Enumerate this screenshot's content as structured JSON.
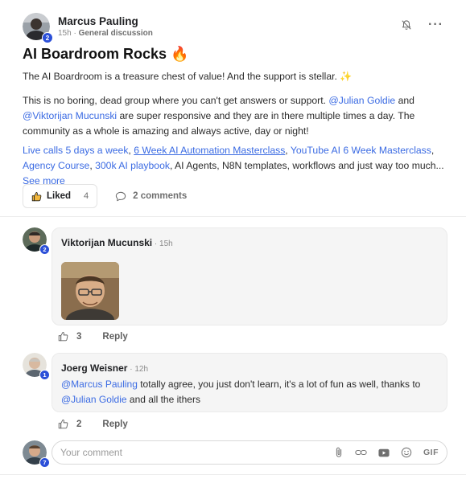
{
  "post": {
    "author": "Marcus Pauling",
    "author_level": "2",
    "time": "15h",
    "separator": " · ",
    "category": "General discussion",
    "title": "AI Boardroom Rocks",
    "title_emoji": "🔥",
    "p1": "The AI Boardroom is a treasure chest of value! And the support is stellar.",
    "p1_emoji": "✨",
    "p2_a": "This is no boring, dead group where you can't get answers or support. ",
    "p2_mention1": "@Julian Goldie",
    "p2_b": " and ",
    "p2_mention2": "@Viktorijan Mucunski",
    "p2_c": " are super responsive and they are in there multiple times a day. The community as a whole is amazing and always active, day or night!",
    "p3_link1": "Live calls 5 days a week",
    "p3_sep1": ", ",
    "p3_link2": "6 Week AI Automation Masterclass",
    "p3_sep2": ", ",
    "p3_link3": "YouTube AI 6 Week Masterclass",
    "p3_sep3": ", ",
    "p3_link4": "Agency Course",
    "p3_sep4": ", ",
    "p3_link5": "300k AI playbook",
    "p3_rest": ", AI Agents, N8N templates, workflows and just way too much... ",
    "see_more": "See more",
    "liked_label": "Liked",
    "like_count": "4",
    "comments_label": "2 comments",
    "icons": {
      "bell": "bell-off-icon",
      "more": "more-icon",
      "like": "thumbs-up-icon",
      "comment": "comment-icon"
    }
  },
  "comments": [
    {
      "author": "Viktorijan Mucunski",
      "level": "2",
      "time": "15h",
      "separator": " · ",
      "likes": "3",
      "reply_label": "Reply"
    },
    {
      "author": "Joerg Weisner",
      "level": "1",
      "time": "12h",
      "separator": " · ",
      "mention1": "@Marcus Pauling",
      "text_a": " totally agree, you just don't learn, it's a lot of fun as well, thanks to ",
      "mention2": "@Julian Goldie",
      "text_b": " and all the ithers",
      "likes": "2",
      "reply_label": "Reply"
    }
  ],
  "composer": {
    "placeholder": "Your comment",
    "user_level": "7",
    "gif_label": "GIF"
  },
  "colors": {
    "accent": "#3b6be3",
    "level_badge": "#2b4fd8",
    "bubble": "#f5f5f5"
  }
}
